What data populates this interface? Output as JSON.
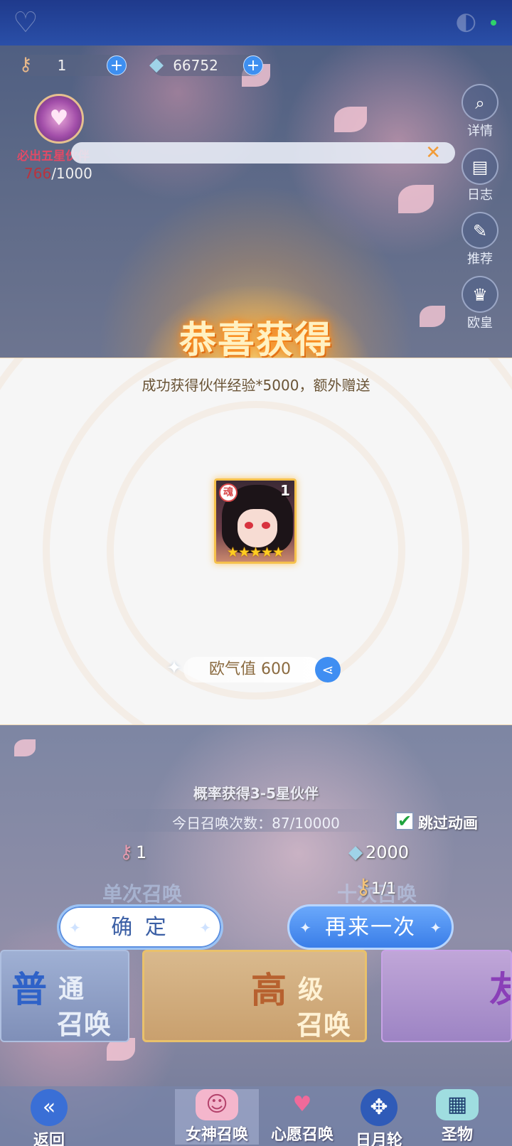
{
  "currencies": [
    {
      "icon": "summon-key-icon",
      "value": "1"
    },
    {
      "icon": "crystal-icon",
      "value": "66752"
    }
  ],
  "pity": {
    "label": "必出五星伙伴",
    "current": "766",
    "total": "/1000"
  },
  "side_menu": [
    {
      "icon": "magnifier-icon",
      "label": "详情"
    },
    {
      "icon": "book-icon",
      "label": "日志"
    },
    {
      "icon": "quill-icon",
      "label": "推荐"
    },
    {
      "icon": "crown-icon",
      "label": "欧皇"
    }
  ],
  "result": {
    "title": "恭喜获得",
    "description": "成功获得伙伴经验*5000，额外赠送",
    "item": {
      "count": "1",
      "stars": "★★★★★",
      "badge": "魂"
    },
    "luck_text": "欧气值 600"
  },
  "summon": {
    "probability": "概率获得3-5星伙伴",
    "today_count": "今日召唤次数：87/10000",
    "skip_label": "跳过动画",
    "skip_checked": true,
    "single_cost": "1",
    "multi_cost": "2000",
    "key_count": "1/1",
    "single_label": "单次召唤",
    "multi_label": "十次召唤"
  },
  "buttons": {
    "confirm": "确 定",
    "again": "再来一次"
  },
  "banners": [
    {
      "big": "普",
      "small1": "通",
      "small2": "召唤"
    },
    {
      "big": "高",
      "small1": "级",
      "small2": "召唤"
    },
    {
      "big": "友",
      "small1": "",
      "small2": ""
    }
  ],
  "nav": [
    {
      "icon": "back-icon",
      "label": "返回"
    },
    {
      "icon": "goddess-icon",
      "label": "女神召唤"
    },
    {
      "icon": "heart-icon",
      "label": "心愿召唤"
    },
    {
      "icon": "compass-icon",
      "label": "日月轮"
    },
    {
      "icon": "relic-icon",
      "label": "圣物"
    }
  ],
  "colors": {
    "accent": "#3f8ef2",
    "gold": "#f5c14c",
    "title_glow": "#ff9d2a"
  }
}
